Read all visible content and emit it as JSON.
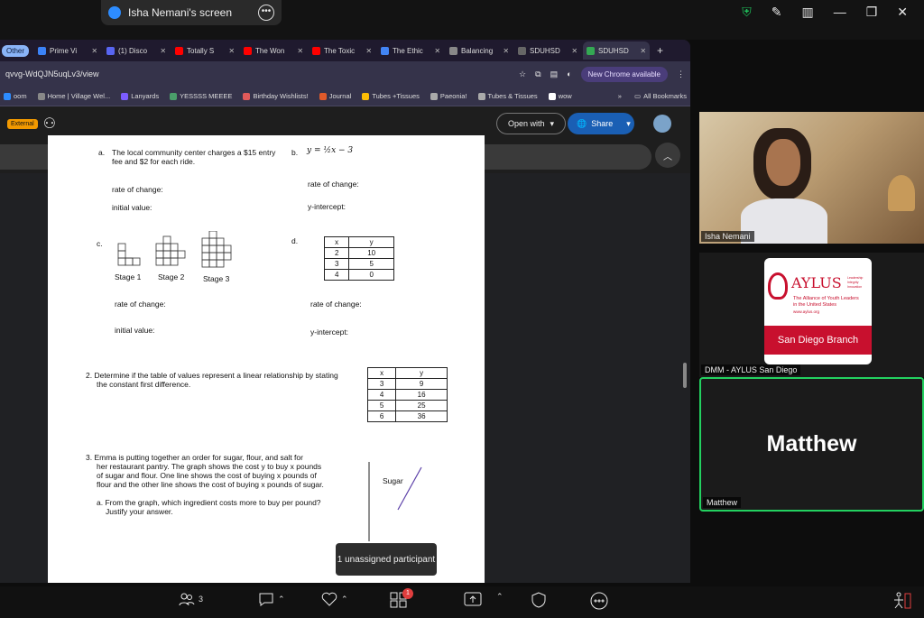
{
  "zoom": {
    "share_title": "Isha Nemani's screen",
    "tooltip": "1 unassigned participant",
    "participants_count": "3",
    "reactions_badge": "1"
  },
  "browser": {
    "tab_group": "Other",
    "tabs": [
      {
        "label": "Prime Vi",
        "color": "#3b82f6"
      },
      {
        "label": "(1) Disco",
        "color": "#5865f2"
      },
      {
        "label": "Totally S",
        "color": "#ff0000"
      },
      {
        "label": "The Won",
        "color": "#ff0000"
      },
      {
        "label": "The Toxic",
        "color": "#ff0000"
      },
      {
        "label": "The Ethic",
        "color": "#4285f4"
      },
      {
        "label": "Balancing",
        "color": "#888888"
      },
      {
        "label": "SDUHSD",
        "color": "#666666"
      },
      {
        "label": "SDUHSD",
        "color": "#34a853"
      }
    ],
    "url": "qvvg-WdQJN5uqLv3/view",
    "new_chrome": "New Chrome available",
    "bookmarks": [
      {
        "label": "oom",
        "color": "#2d8cff"
      },
      {
        "label": "Home | Village Wel...",
        "color": "#888888"
      },
      {
        "label": "Lanyards",
        "color": "#7b5cff"
      },
      {
        "label": "YESSSS MEEEE",
        "color": "#4a9e6a"
      },
      {
        "label": "Birthday Wishlists!",
        "color": "#e05a5a"
      },
      {
        "label": "Journal",
        "color": "#e05a2a"
      },
      {
        "label": "Tubes +Tissues",
        "color": "#fbbc05"
      },
      {
        "label": "Paeonia!",
        "color": "#aaaaaa"
      },
      {
        "label": "Tubes & Tissues",
        "color": "#aaaaaa"
      },
      {
        "label": "wow",
        "color": "#ffffff"
      }
    ],
    "bookmarks_more": "»",
    "all_bookmarks": "All Bookmarks",
    "external": "External",
    "open_with": "Open with",
    "share": "Share"
  },
  "worksheet": {
    "qa_label": "a.",
    "qa_text1": "The local community center charges a $15 entry",
    "qa_text2": "fee and $2 for each ride.",
    "qb_label": "b.",
    "qb_eq": "y = ½x − 3",
    "roc": "rate of change:",
    "init": "initial value:",
    "yint": "y-intercept:",
    "qc_label": "c.",
    "qd_label": "d.",
    "stage1": "Stage 1",
    "stage2": "Stage 2",
    "stage3": "Stage 3",
    "table_d": {
      "headers": [
        "x",
        "y"
      ],
      "rows": [
        [
          "2",
          "10"
        ],
        [
          "3",
          "5"
        ],
        [
          "4",
          "0"
        ]
      ]
    },
    "q2_1": "2.  Determine if the table of values represent a linear relationship by stating",
    "q2_2": "the constant first difference.",
    "table_2": {
      "headers": [
        "x",
        "y"
      ],
      "rows": [
        [
          "3",
          "9"
        ],
        [
          "4",
          "16"
        ],
        [
          "5",
          "25"
        ],
        [
          "6",
          "36"
        ]
      ]
    },
    "q3_1": "3.  Emma is putting together an order for sugar, flour, and salt for",
    "q3_2": "her restaurant pantry. The graph shows the cost y to buy x pounds",
    "q3_3": "of sugar and flour. One line shows the cost of buying x pounds of",
    "q3_4": "flour and the other line shows the cost of buying x pounds of sugar.",
    "q3a_1": "a.  From the graph, which ingredient costs more to buy per pound?",
    "q3a_2": "Justify your answer.",
    "sugar": "Sugar"
  },
  "participants": {
    "p1": "Isha Nemani",
    "p2": "DMM - AYLUS San Diego",
    "p3": "Matthew",
    "p3_big": "Matthew",
    "aylus_title": "AYLUS",
    "aylus_tag1": "Leadership",
    "aylus_tag2": "Integrity",
    "aylus_tag3": "Innovation",
    "aylus_full1": "The Alliance of Youth Leaders",
    "aylus_full2": "in the United States",
    "aylus_web": "www.aylus.org",
    "aylus_branch": "San Diego Branch"
  }
}
